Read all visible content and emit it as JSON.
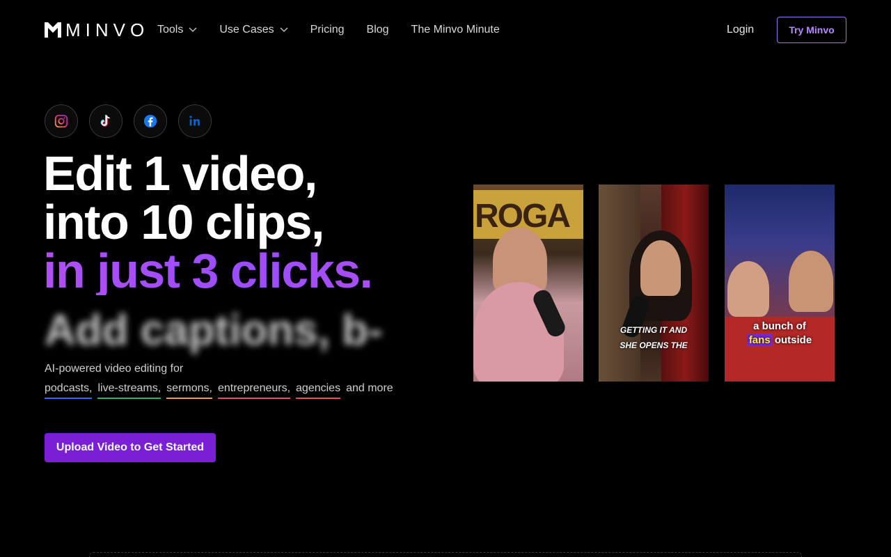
{
  "nav": {
    "logo_text": "MINVO",
    "links": [
      {
        "label": "Tools",
        "dropdown": true
      },
      {
        "label": "Use Cases",
        "dropdown": true
      },
      {
        "label": "Pricing",
        "dropdown": false
      },
      {
        "label": "Blog",
        "dropdown": false
      },
      {
        "label": "The Minvo Minute",
        "dropdown": false
      }
    ],
    "login_label": "Login",
    "try_label": "Try Minvo"
  },
  "socials": [
    "instagram-icon",
    "tiktok-icon",
    "facebook-icon",
    "linkedin-icon"
  ],
  "hero": {
    "line1": "Edit 1 video,",
    "line2": "into 10 clips,",
    "line3": "in just 3 clicks.",
    "blurred_text": "Add captions, b-",
    "subtitle": "AI-powered video editing for",
    "use_cases": [
      "podcasts,",
      "live-streams,",
      "sermons,",
      "entrepreneurs,",
      "agencies"
    ],
    "and_more": "and more",
    "cta_label": "Upload Video to Get Started"
  },
  "videos": {
    "v1_sign": "ROGA",
    "v2_caption_1": "GETTING IT AND",
    "v2_caption_2": "SHE OPENS THE",
    "v3_caption_1": "a bunch of",
    "v3_caption_highlight": "fans",
    "v3_caption_2": " outside"
  },
  "colors": {
    "accent": "#7a1fd6",
    "accent_border": "#a472f5",
    "headline_purple": "#a94ef2"
  }
}
